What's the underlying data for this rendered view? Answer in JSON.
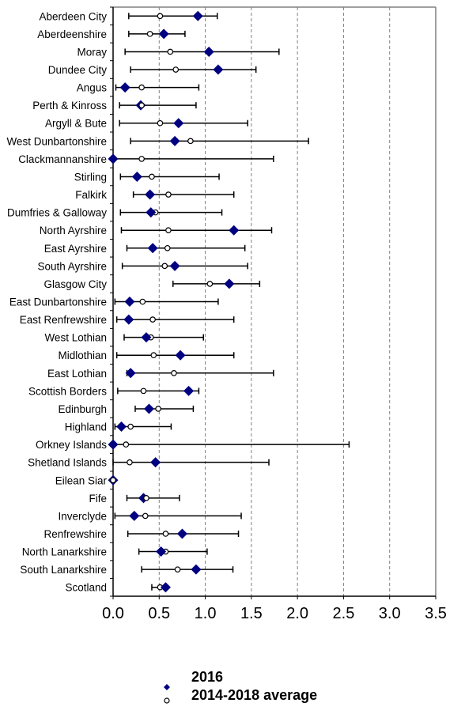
{
  "chart_data": {
    "type": "scatter",
    "subtype": "horizontal-dot-plot-with-error-bars",
    "title": "",
    "xlabel": "",
    "ylabel": "",
    "xlim": [
      0.0,
      3.5
    ],
    "xticks": [
      "0.0",
      "0.5",
      "1.0",
      "1.5",
      "2.0",
      "2.5",
      "3.0",
      "3.5"
    ],
    "xtick_values": [
      0.0,
      0.5,
      1.0,
      1.5,
      2.0,
      2.5,
      3.0,
      3.5
    ],
    "grid": "vertical dashed at each major tick",
    "legend_position": "bottom-center",
    "categories": [
      "Aberdeen City",
      "Aberdeenshire",
      "Moray",
      "Dundee City",
      "Angus",
      "Perth & Kinross",
      "Argyll & Bute",
      "West Dunbartonshire",
      "Clackmannanshire",
      "Stirling",
      "Falkirk",
      "Dumfries & Galloway",
      "North Ayrshire",
      "East Ayrshire",
      "South Ayrshire",
      "Glasgow City",
      "East Dunbartonshire",
      "East Renfrewshire",
      "West Lothian",
      "Midlothian",
      "East Lothian",
      "Scottish Borders",
      "Edinburgh",
      "Highland",
      "Orkney Islands",
      "Shetland Islands",
      "Eilean Siar",
      "Fife",
      "Inverclyde",
      "Renfrewshire",
      "North Lanarkshire",
      "South Lanarkshire",
      "Scotland"
    ],
    "series": [
      {
        "name": "2016",
        "marker": "diamond",
        "color": "#000080",
        "values": [
          0.92,
          0.55,
          1.04,
          1.14,
          0.13,
          0.3,
          0.71,
          0.67,
          0.0,
          0.26,
          0.4,
          0.41,
          1.31,
          0.43,
          0.67,
          1.26,
          0.18,
          0.17,
          0.36,
          0.73,
          0.19,
          0.82,
          0.39,
          0.09,
          0.0,
          0.46,
          0.0,
          0.33,
          0.23,
          0.75,
          0.52,
          0.9,
          0.57
        ]
      },
      {
        "name": "2014-2018 average",
        "marker": "open-circle",
        "color": "#000000",
        "values": [
          0.51,
          0.4,
          0.62,
          0.68,
          0.31,
          0.31,
          0.51,
          0.84,
          0.31,
          0.42,
          0.6,
          0.46,
          0.6,
          0.59,
          0.56,
          1.05,
          0.32,
          0.43,
          0.41,
          0.44,
          0.66,
          0.33,
          0.49,
          0.19,
          0.14,
          0.18,
          0.0,
          0.36,
          0.35,
          0.57,
          0.57,
          0.7,
          0.51
        ]
      }
    ],
    "error_bars": {
      "applies_to": "2016",
      "lower": [
        0.17,
        0.17,
        0.13,
        0.19,
        0.03,
        0.07,
        0.07,
        0.19,
        0.0,
        0.08,
        0.22,
        0.08,
        0.09,
        0.15,
        0.1,
        0.65,
        0.02,
        0.04,
        0.12,
        0.04,
        0.15,
        0.05,
        0.24,
        0.02,
        0.0,
        0.0,
        null,
        0.15,
        0.02,
        0.16,
        0.28,
        0.31,
        0.42
      ],
      "upper": [
        1.13,
        0.78,
        1.8,
        1.55,
        0.93,
        0.9,
        1.46,
        2.12,
        1.74,
        1.15,
        1.31,
        1.18,
        1.72,
        1.43,
        1.46,
        1.59,
        1.14,
        1.31,
        0.98,
        1.31,
        1.74,
        0.93,
        0.87,
        0.63,
        2.56,
        1.69,
        null,
        0.72,
        1.39,
        1.36,
        1.02,
        1.3,
        0.58
      ]
    },
    "colors": {
      "diamond": "#000080",
      "axis": "#000000",
      "frame": "#808080",
      "grid": "#808080"
    }
  },
  "legend": {
    "items": [
      {
        "label": "2016",
        "marker": "diamond"
      },
      {
        "label": "2014-2018 average",
        "marker": "open-circle"
      }
    ]
  }
}
